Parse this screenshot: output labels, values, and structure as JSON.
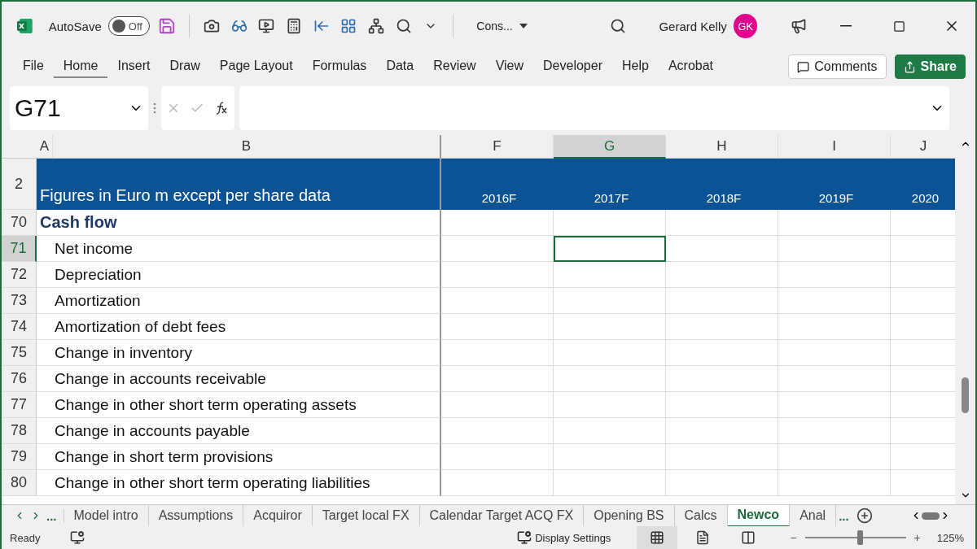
{
  "title_bar": {
    "autosave_label": "AutoSave",
    "autosave": {
      "label": "Off",
      "on": false
    },
    "file_name": "Cons...",
    "user_name": "Gerard Kelly",
    "user_initials": "GK"
  },
  "ribbon_tabs": [
    {
      "label": "File",
      "selected": false
    },
    {
      "label": "Home",
      "selected": true
    },
    {
      "label": "Insert",
      "selected": false
    },
    {
      "label": "Draw",
      "selected": false
    },
    {
      "label": "Page Layout",
      "selected": false
    },
    {
      "label": "Formulas",
      "selected": false
    },
    {
      "label": "Data",
      "selected": false
    },
    {
      "label": "Review",
      "selected": false
    },
    {
      "label": "View",
      "selected": false
    },
    {
      "label": "Developer",
      "selected": false
    },
    {
      "label": "Help",
      "selected": false
    },
    {
      "label": "Acrobat",
      "selected": false
    }
  ],
  "ribbon_buttons": [
    {
      "label": "Comments",
      "kind": "comments"
    },
    {
      "label": "Share",
      "kind": "share"
    }
  ],
  "name_box": "G71",
  "columns": [
    {
      "label": "A",
      "selected": false
    },
    {
      "label": "B",
      "selected": false
    },
    {
      "label": "F",
      "selected": false
    },
    {
      "label": "G",
      "selected": true
    },
    {
      "label": "H",
      "selected": false
    },
    {
      "label": "I",
      "selected": false
    },
    {
      "label": "J",
      "selected": false
    }
  ],
  "header_row": {
    "number": "2",
    "title": "Figures in Euro m except per share data",
    "years": [
      "2016F",
      "2017F",
      "2018F",
      "2019F",
      "2020"
    ]
  },
  "rows": [
    {
      "number": "70",
      "label": "Cash flow",
      "kind": "heading",
      "selected": false
    },
    {
      "number": "71",
      "label": "Net income",
      "kind": "item",
      "selected": true
    },
    {
      "number": "72",
      "label": "Depreciation",
      "kind": "item",
      "selected": false
    },
    {
      "number": "73",
      "label": "Amortization",
      "kind": "item",
      "selected": false
    },
    {
      "number": "74",
      "label": "Amortization of debt fees",
      "kind": "item",
      "selected": false
    },
    {
      "number": "75",
      "label": "Change in inventory",
      "kind": "item",
      "selected": false
    },
    {
      "number": "76",
      "label": "Change in accounts receivable",
      "kind": "item",
      "selected": false
    },
    {
      "number": "77",
      "label": "Change in other short term operating assets",
      "kind": "item",
      "selected": false
    },
    {
      "number": "78",
      "label": "Change in accounts payable",
      "kind": "item",
      "selected": false
    },
    {
      "number": "79",
      "label": "Change in short term provisions",
      "kind": "item",
      "selected": false
    },
    {
      "number": "80",
      "label": "Change in other short term operating liabilities",
      "kind": "item",
      "selected": false
    }
  ],
  "sheet_nav": {
    "more_left": "...",
    "more_right": "..."
  },
  "sheet_tabs": [
    {
      "label": "Model intro",
      "selected": false
    },
    {
      "label": "Assumptions",
      "selected": false
    },
    {
      "label": "Acquiror",
      "selected": false
    },
    {
      "label": "Target local FX",
      "selected": false
    },
    {
      "label": "Calendar Target ACQ FX",
      "selected": false
    },
    {
      "label": "Opening BS",
      "selected": false
    },
    {
      "label": "Calcs",
      "selected": false
    },
    {
      "label": "Newco",
      "selected": true
    },
    {
      "label": "Anal",
      "selected": false
    }
  ],
  "status_bar": {
    "mode": "Ready",
    "display_settings": "Display Settings",
    "views": [
      {
        "kind": "normal",
        "selected": true
      },
      {
        "kind": "page-layout",
        "selected": false
      },
      {
        "kind": "page-break",
        "selected": false
      }
    ],
    "zoom_minus": "−",
    "zoom_plus": "+",
    "zoom_slider": {
      "level": 0.54
    },
    "zoom": "125%"
  }
}
